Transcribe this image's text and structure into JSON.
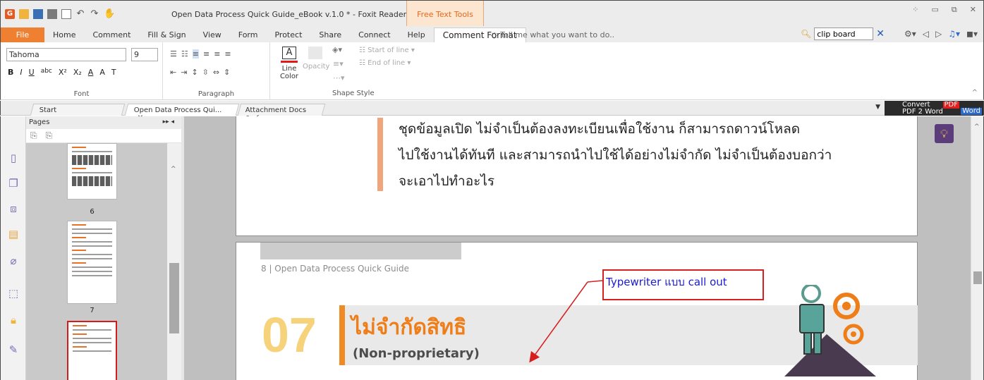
{
  "window": {
    "title": "Open Data Process Quick Guide_eBook v.1.0 * - Foxit Reader",
    "context_tool": "Free Text Tools",
    "controls": [
      "⁘",
      "▭",
      "⧉",
      "✕"
    ]
  },
  "ribbon_tabs": {
    "file": "File",
    "items": [
      "Home",
      "Comment",
      "Fill & Sign",
      "View",
      "Form",
      "Protect",
      "Share",
      "Connect",
      "Help",
      "Comment Format"
    ],
    "active": "Comment Format",
    "tell_me": "Tell me what you want to do..",
    "search_value": "clip board"
  },
  "font_group": {
    "font_name": "Tahoma",
    "font_size": "9",
    "format_buttons": [
      "B",
      "I",
      "U",
      "abc",
      "X²",
      "X₂",
      "A",
      "A",
      "T"
    ],
    "label": "Font"
  },
  "paragraph_group": {
    "label": "Paragraph"
  },
  "shape_group": {
    "line_color_label": "Line",
    "line_color_label2": "Color",
    "opacity_label": "Opacity",
    "start_of_line": "Start of line",
    "end_of_line": "End of line",
    "label": "Shape Style"
  },
  "doc_tabs": [
    {
      "label": "Start"
    },
    {
      "label": "Open Data Process Qui..."
    },
    {
      "label": "Attachment Docs พิมพ์..."
    }
  ],
  "convert": {
    "line1": "Convert",
    "line2": "PDF 2 Word",
    "pdf": "PDF",
    "word": "Word"
  },
  "pages_panel": {
    "title": "Pages",
    "page_numbers": [
      "6",
      "7"
    ]
  },
  "document": {
    "quote_lines": [
      "ชุดข้อมูลเปิด ไม่จำเป็นต้องลงทะเบียนเพื่อใช้งาน ก็สามารถดาวน์โหลด",
      "ไปใช้งานได้ทันที และสามารถนำไปใช้ได้อย่างไม่จำกัด ไม่จำเป็นต้องบอกว่า",
      "จะเอาไปทำอะไร"
    ],
    "running_header": "8  |  Open Data Process Quick Guide",
    "callout_text": "Typewriter แบบ call out",
    "section_number": "07",
    "section_title_thai": "ไม่จำกัดสิทธิ",
    "section_title_en": "(Non-proprietary)"
  },
  "colors": {
    "file_tab": "#f08031",
    "callout_border": "#d61f1f",
    "callout_text": "#1a1ad4",
    "heading_orange": "#ef7d18",
    "section_number": "#f6d27a"
  }
}
